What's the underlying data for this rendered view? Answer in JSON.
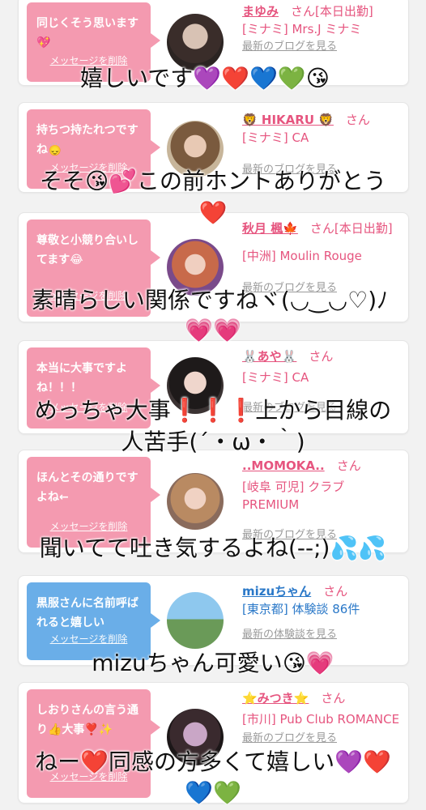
{
  "cards": [
    {
      "message": "同じくそう思います💖",
      "delete_label": "メッセージを削除",
      "name": "まゆみ",
      "suffix": "さん[本日出勤]",
      "shop": "[ミナミ] Mrs.J ミナミ",
      "blog": "最新のブログを見る",
      "theme": "pink"
    },
    {
      "message": "持ちつ持たれつですね🙂‍↕️",
      "delete_label": "メッセージを削除",
      "name": "🦁 HIKARU 🦁",
      "suffix": "さん",
      "shop": "[ミナミ] CA",
      "blog": "最新のブログを見る",
      "theme": "pink"
    },
    {
      "message": "尊敬と小競り合いしてます😂",
      "delete_label": "メッセージを削除",
      "name": "秋月 楓🍁",
      "suffix": "さん[本日出勤]",
      "shop": "[中洲] Moulin Rouge",
      "blog": "最新のブログを見る",
      "theme": "pink"
    },
    {
      "message": "本当に大事ですよね！！！",
      "delete_label": "メッセージを削除",
      "name": "🐰あや🐰",
      "suffix": "さん",
      "shop": "[ミナミ] CA",
      "blog": "最新のブログを見る",
      "theme": "pink"
    },
    {
      "message": "ほんとその通りですよね←",
      "delete_label": "メッセージを削除",
      "name": "..MOMOKA..",
      "suffix": "さん",
      "shop": "[岐阜 可児] クラブ PREMIUM",
      "blog": "最新のブログを見る",
      "theme": "pink"
    },
    {
      "message": "黒服さんに名前呼ばれると嬉しい",
      "delete_label": "メッセージを削除",
      "name": "mizuちゃん",
      "suffix": "さん",
      "shop": "[東京都] 体験談 86件",
      "blog": "最新の体験談を見る",
      "theme": "blue"
    },
    {
      "message": "しおりさんの言う通り👍大事❣️✨",
      "delete_label": "メッセージを削除",
      "name": "⭐みつき⭐",
      "suffix": "さん",
      "shop": "[市川] Pub Club ROMANCE",
      "blog": "最新のブログを見る",
      "theme": "pink"
    }
  ],
  "overlays": [
    "嬉しいです💜❤️💙💚😘",
    "そそ😘💕この前ホントありがとう❤️",
    "素晴らしい関係ですねヾ(◡‿◡♡)ﾉ💗💗",
    "めっちゃ大事❗️❗️❗️上から目線の人苦手(´・ω・｀)",
    "聞いてて吐き気するよね(--;)💦💦",
    "mizuちゃん可愛い😘💗",
    "ねー❤️同感の方多くて嬉しい💜❤️💙💚"
  ],
  "overlay_lines": {
    "o1": "嬉しいです",
    "o1_hearts": "💜❤️💙💚",
    "o1_face": "😘",
    "o2a": "そそ",
    "o2_face": "😘",
    "o2_heart": "💕",
    "o2b": "この前ホントありがとう",
    "o2_red": "❤️",
    "o3a": "素晴らしい関係ですねヾ(◡‿◡♡)ﾉ",
    "o3_hearts": "💗💗",
    "o4a": "めっちゃ大事",
    "o4_marks": "❗️❗️❗️",
    "o4b": "上から目線の",
    "o4c": "人苦手(´・ω・｀)",
    "o5a": "聞いてて吐き気するよね(--;)",
    "o5_drops": "💦💦",
    "o6a": "mizuちゃん可愛い",
    "o6_face": "😘",
    "o6_heart": "💗",
    "o7a": "ねー",
    "o7_red": "❤️",
    "o7b": "同感の方多くて嬉しい",
    "o7_hearts1": "💜❤️",
    "o7_hearts2": "💙💚"
  }
}
